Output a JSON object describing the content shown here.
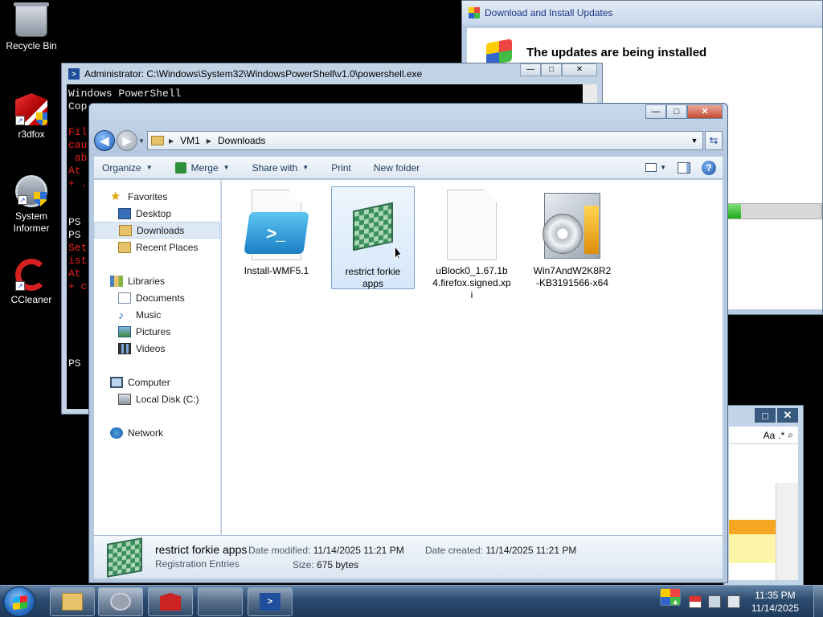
{
  "desktop": {
    "icons": [
      {
        "label": "Recycle Bin"
      },
      {
        "label": "r3dfox"
      },
      {
        "label": "System\nInformer"
      },
      {
        "label": "CCleaner"
      }
    ]
  },
  "windows_update": {
    "title": "Download and Install Updates",
    "heading": "The updates are being installed",
    "progress": 0.17
  },
  "background_window": {
    "ribbon_text": "Aa"
  },
  "powershell": {
    "title": "Administrator: C:\\Windows\\System32\\WindowsPowerShell\\v1.0\\powershell.exe",
    "lines": [
      {
        "text": "Windows PowerShell",
        "err": false
      },
      {
        "text": "Cop",
        "err": false
      },
      {
        "text": "",
        "err": false
      },
      {
        "text": "Fil",
        "err": true
      },
      {
        "text": "cau",
        "err": true
      },
      {
        "text": " ab",
        "err": true
      },
      {
        "text": "At ",
        "err": true
      },
      {
        "text": "+ .",
        "err": true
      },
      {
        "text": "",
        "err": false
      },
      {
        "text": "",
        "err": false
      },
      {
        "text": "PS ",
        "err": false
      },
      {
        "text": "PS ",
        "err": false
      },
      {
        "text": "Set",
        "err": true
      },
      {
        "text": "ist",
        "err": true
      },
      {
        "text": "At ",
        "err": true
      },
      {
        "text": "+ c",
        "err": true
      },
      {
        "text": "",
        "err": false
      },
      {
        "text": "",
        "err": false
      },
      {
        "text": "",
        "err": false
      },
      {
        "text": "",
        "err": false
      },
      {
        "text": "",
        "err": false
      },
      {
        "text": "PS ",
        "err": false
      }
    ]
  },
  "explorer": {
    "breadcrumb": [
      "VM1",
      "Downloads"
    ],
    "toolbar": {
      "organize": "Organize",
      "merge": "Merge",
      "share_with": "Share with",
      "print": "Print",
      "new_folder": "New folder"
    },
    "nav": {
      "favorites": "Favorites",
      "desktop": "Desktop",
      "downloads": "Downloads",
      "recent_places": "Recent Places",
      "libraries": "Libraries",
      "documents": "Documents",
      "music": "Music",
      "pictures": "Pictures",
      "videos": "Videos",
      "computer": "Computer",
      "local_disk": "Local Disk (C:)",
      "network": "Network"
    },
    "files": [
      {
        "name": "Install-WMF5.1"
      },
      {
        "name": "restrict forkie apps"
      },
      {
        "name": "uBlock0_1.67.1b4.firefox.signed.xpi"
      },
      {
        "name": "Win7AndW2K8R2-KB3191566-x64"
      }
    ],
    "details": {
      "name": "restrict forkie apps",
      "type": "Registration Entries",
      "date_modified_label": "Date modified:",
      "date_modified": "11/14/2025 11:21 PM",
      "date_created_label": "Date created:",
      "date_created": "11/14/2025 11:21 PM",
      "size_label": "Size:",
      "size": "675 bytes"
    }
  },
  "taskbar": {
    "time": "11:35 PM",
    "date": "11/14/2025"
  }
}
